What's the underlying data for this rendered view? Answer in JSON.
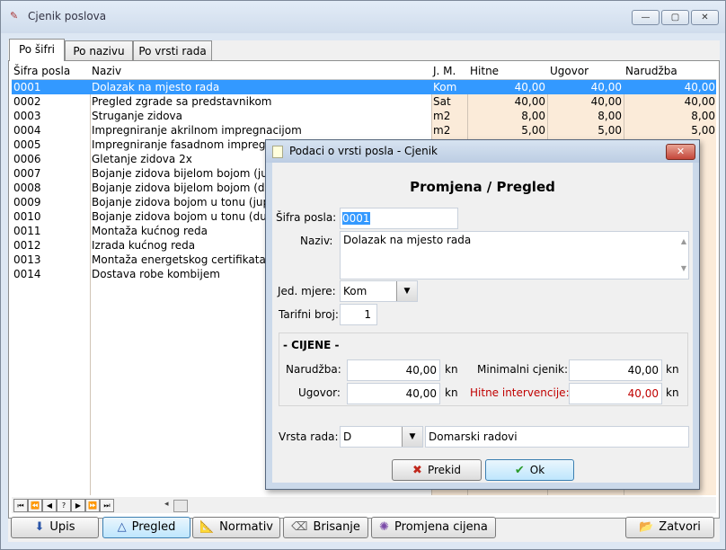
{
  "window": {
    "title": "Cjenik poslova",
    "minimize": "—",
    "maximize": "▢",
    "close": "✕"
  },
  "tabs": [
    {
      "label": "Po šifri"
    },
    {
      "label": "Po nazivu"
    },
    {
      "label": "Po vrsti rada"
    }
  ],
  "grid": {
    "headers": {
      "sifra": "Šifra posla",
      "naziv": "Naziv",
      "jm": "J. M.",
      "hitne": "Hitne",
      "ugovor": "Ugovor",
      "narudzba": "Narudžba"
    },
    "rows": [
      {
        "sifra": "0001",
        "naziv": "Dolazak na mjesto rada",
        "jm": "Kom",
        "hitne": "40,00",
        "ugovor": "40,00",
        "narudzba": "40,00"
      },
      {
        "sifra": "0002",
        "naziv": "Pregled zgrade sa predstavnikom",
        "jm": "Sat",
        "hitne": "40,00",
        "ugovor": "40,00",
        "narudzba": "40,00"
      },
      {
        "sifra": "0003",
        "naziv": "Struganje zidova",
        "jm": "m2",
        "hitne": "8,00",
        "ugovor": "8,00",
        "narudzba": "8,00"
      },
      {
        "sifra": "0004",
        "naziv": "Impregniranje akrilnom impregnacijom",
        "jm": "m2",
        "hitne": "5,00",
        "ugovor": "5,00",
        "narudzba": "5,00"
      },
      {
        "sifra": "0005",
        "naziv": "Impregniranje fasadnom impregn",
        "jm": "",
        "hitne": "",
        "ugovor": "",
        "narudzba": ""
      },
      {
        "sifra": "0006",
        "naziv": "Gletanje zidova 2x",
        "jm": "",
        "hitne": "",
        "ugovor": "",
        "narudzba": ""
      },
      {
        "sifra": "0007",
        "naziv": "Bojanje zidova bijelom bojom (ju",
        "jm": "",
        "hitne": "",
        "ugovor": "",
        "narudzba": ""
      },
      {
        "sifra": "0008",
        "naziv": "Bojanje zidova bijelom bojom (du",
        "jm": "",
        "hitne": "",
        "ugovor": "",
        "narudzba": ""
      },
      {
        "sifra": "0009",
        "naziv": "Bojanje zidova bojom u tonu (jup",
        "jm": "",
        "hitne": "",
        "ugovor": "",
        "narudzba": ""
      },
      {
        "sifra": "0010",
        "naziv": "Bojanje zidova bojom u tonu (dul",
        "jm": "",
        "hitne": "",
        "ugovor": "",
        "narudzba": ""
      },
      {
        "sifra": "0011",
        "naziv": "Montaža kućnog reda",
        "jm": "",
        "hitne": "",
        "ugovor": "",
        "narudzba": ""
      },
      {
        "sifra": "0012",
        "naziv": "Izrada kućnog reda",
        "jm": "",
        "hitne": "",
        "ugovor": "",
        "narudzba": ""
      },
      {
        "sifra": "0013",
        "naziv": "Montaža energetskog certifikata",
        "jm": "",
        "hitne": "",
        "ugovor": "",
        "narudzba": ""
      },
      {
        "sifra": "0014",
        "naziv": "Dostava robe kombijem",
        "jm": "",
        "hitne": "",
        "ugovor": "",
        "narudzba": ""
      }
    ]
  },
  "nav": {
    "first": "⏮",
    "prev_page": "⏪",
    "prev": "◀",
    "help": "?",
    "next": "▶",
    "next_page": "⏩",
    "last": "⏭"
  },
  "buttons": {
    "upis": "Upis",
    "pregled": "Pregled",
    "normativ": "Normativ",
    "brisanje": "Brisanje",
    "promjena_cijena": "Promjena cijena",
    "zatvori": "Zatvori"
  },
  "dialog": {
    "title": "Podaci o vrsti posla - Cjenik",
    "heading": "Promjena / Pregled",
    "sifra_label": "Šifra posla:",
    "sifra_value": "0001",
    "naziv_label": "Naziv:",
    "naziv_value": "Dolazak na mjesto rada",
    "jm_label": "Jed. mjere:",
    "jm_value": "Kom",
    "tarifni_label": "Tarifni broj:",
    "tarifni_value": "1",
    "cijene_group": "- CIJENE -",
    "narudzba_label": "Narudžba:",
    "narudzba_value": "40,00",
    "ugovor_label": "Ugovor:",
    "ugovor_value": "40,00",
    "minimalni_label": "Minimalni cjenik:",
    "minimalni_value": "40,00",
    "hitne_label": "Hitne intervencije:",
    "hitne_value": "40,00",
    "unit": "kn",
    "vrsta_label": "Vrsta rada:",
    "vrsta_value": "D",
    "vrsta_desc": "Domarski radovi",
    "prekid": "Prekid",
    "ok": "Ok"
  },
  "colors": {
    "selection": "#3399ff",
    "grid_bg": "#fbebd9",
    "hitne_label": "#c00000"
  }
}
